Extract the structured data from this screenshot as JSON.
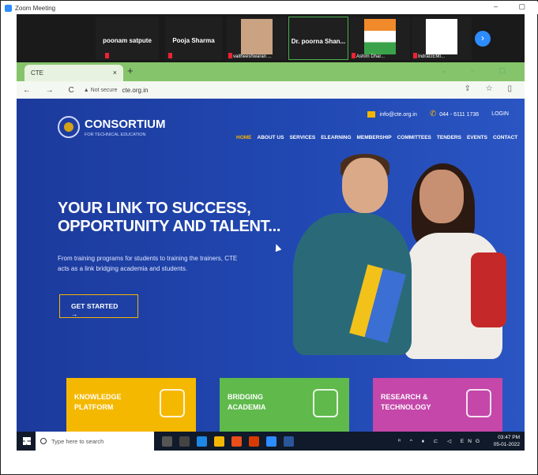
{
  "zoom": {
    "window_title": "Zoom Meeting",
    "window_controls": "–  ▢",
    "participants": [
      {
        "name": "poonam satpute",
        "caption": ""
      },
      {
        "name": "Pooja Sharma",
        "caption": ""
      },
      {
        "name": "",
        "caption": "vaitheeshwaran ..."
      },
      {
        "name": "Dr. poorna Shan...",
        "caption": ""
      },
      {
        "name": "",
        "caption": "Ashim Dhar..."
      },
      {
        "name": "",
        "caption": "IndraGEMI..."
      }
    ],
    "next_label": "›"
  },
  "browser": {
    "tab_title": "CTE",
    "tab_close": "×",
    "new_tab": "+",
    "window_controls": "⌄ – ▢",
    "nav_buttons": "← → C",
    "security": "▲ Not secure",
    "url": "cte.org.in",
    "right_icons": "⇪ ☆ ▯"
  },
  "site": {
    "email": "info@cte.org.in",
    "phone": "044 - 6111 1736",
    "login": "LOGIN",
    "logo_title": "CONSORTIUM",
    "logo_subtitle": "FOR TECHNICAL EDUCATION",
    "menu": [
      "HOME",
      "ABOUT US",
      "SERVICES",
      "ELEARNING",
      "MEMBERSHIP",
      "COMMITTEES",
      "TENDERS",
      "EVENTS",
      "CONTACT"
    ],
    "hero_line1": "YOUR LINK TO SUCCESS,",
    "hero_line2": "OPPORTUNITY AND TALENT...",
    "hero_text": "From training programs for students to training the trainers, CTE acts as a link bridging academia and students.",
    "cta": "GET STARTED  →",
    "cards": [
      {
        "line1": "KNOWLEDGE",
        "line2": "PLATFORM",
        "color": "#f5b800"
      },
      {
        "line1": "BRIDGING",
        "line2": "ACADEMIA",
        "color": "#5fb94b"
      },
      {
        "line1": "RESEARCH &",
        "line2": "TECHNOLOGY",
        "color": "#c447a9"
      }
    ]
  },
  "taskbar": {
    "search_placeholder": "Type here to search",
    "tray_icons": "ᴿ ^ ♦ ⊏ ◁ ENG",
    "time": "03:47 PM",
    "date": "05-01-2022"
  }
}
